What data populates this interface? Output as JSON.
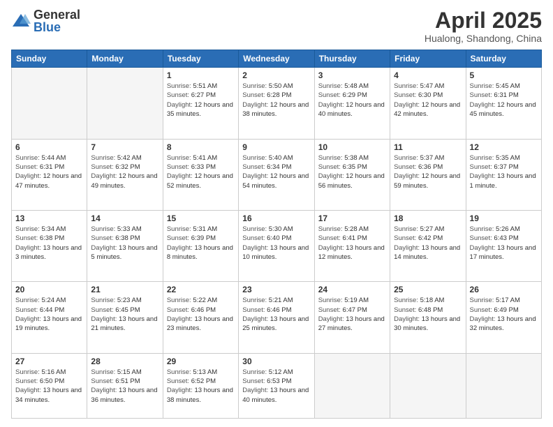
{
  "header": {
    "logo_general": "General",
    "logo_blue": "Blue",
    "month_title": "April 2025",
    "location": "Hualong, Shandong, China"
  },
  "days_of_week": [
    "Sunday",
    "Monday",
    "Tuesday",
    "Wednesday",
    "Thursday",
    "Friday",
    "Saturday"
  ],
  "weeks": [
    [
      {
        "day": "",
        "empty": true
      },
      {
        "day": "",
        "empty": true
      },
      {
        "day": "1",
        "sunrise": "5:51 AM",
        "sunset": "6:27 PM",
        "daylight": "12 hours and 35 minutes."
      },
      {
        "day": "2",
        "sunrise": "5:50 AM",
        "sunset": "6:28 PM",
        "daylight": "12 hours and 38 minutes."
      },
      {
        "day": "3",
        "sunrise": "5:48 AM",
        "sunset": "6:29 PM",
        "daylight": "12 hours and 40 minutes."
      },
      {
        "day": "4",
        "sunrise": "5:47 AM",
        "sunset": "6:30 PM",
        "daylight": "12 hours and 42 minutes."
      },
      {
        "day": "5",
        "sunrise": "5:45 AM",
        "sunset": "6:31 PM",
        "daylight": "12 hours and 45 minutes."
      }
    ],
    [
      {
        "day": "6",
        "sunrise": "5:44 AM",
        "sunset": "6:31 PM",
        "daylight": "12 hours and 47 minutes."
      },
      {
        "day": "7",
        "sunrise": "5:42 AM",
        "sunset": "6:32 PM",
        "daylight": "12 hours and 49 minutes."
      },
      {
        "day": "8",
        "sunrise": "5:41 AM",
        "sunset": "6:33 PM",
        "daylight": "12 hours and 52 minutes."
      },
      {
        "day": "9",
        "sunrise": "5:40 AM",
        "sunset": "6:34 PM",
        "daylight": "12 hours and 54 minutes."
      },
      {
        "day": "10",
        "sunrise": "5:38 AM",
        "sunset": "6:35 PM",
        "daylight": "12 hours and 56 minutes."
      },
      {
        "day": "11",
        "sunrise": "5:37 AM",
        "sunset": "6:36 PM",
        "daylight": "12 hours and 59 minutes."
      },
      {
        "day": "12",
        "sunrise": "5:35 AM",
        "sunset": "6:37 PM",
        "daylight": "13 hours and 1 minute."
      }
    ],
    [
      {
        "day": "13",
        "sunrise": "5:34 AM",
        "sunset": "6:38 PM",
        "daylight": "13 hours and 3 minutes."
      },
      {
        "day": "14",
        "sunrise": "5:33 AM",
        "sunset": "6:38 PM",
        "daylight": "13 hours and 5 minutes."
      },
      {
        "day": "15",
        "sunrise": "5:31 AM",
        "sunset": "6:39 PM",
        "daylight": "13 hours and 8 minutes."
      },
      {
        "day": "16",
        "sunrise": "5:30 AM",
        "sunset": "6:40 PM",
        "daylight": "13 hours and 10 minutes."
      },
      {
        "day": "17",
        "sunrise": "5:28 AM",
        "sunset": "6:41 PM",
        "daylight": "13 hours and 12 minutes."
      },
      {
        "day": "18",
        "sunrise": "5:27 AM",
        "sunset": "6:42 PM",
        "daylight": "13 hours and 14 minutes."
      },
      {
        "day": "19",
        "sunrise": "5:26 AM",
        "sunset": "6:43 PM",
        "daylight": "13 hours and 17 minutes."
      }
    ],
    [
      {
        "day": "20",
        "sunrise": "5:24 AM",
        "sunset": "6:44 PM",
        "daylight": "13 hours and 19 minutes."
      },
      {
        "day": "21",
        "sunrise": "5:23 AM",
        "sunset": "6:45 PM",
        "daylight": "13 hours and 21 minutes."
      },
      {
        "day": "22",
        "sunrise": "5:22 AM",
        "sunset": "6:46 PM",
        "daylight": "13 hours and 23 minutes."
      },
      {
        "day": "23",
        "sunrise": "5:21 AM",
        "sunset": "6:46 PM",
        "daylight": "13 hours and 25 minutes."
      },
      {
        "day": "24",
        "sunrise": "5:19 AM",
        "sunset": "6:47 PM",
        "daylight": "13 hours and 27 minutes."
      },
      {
        "day": "25",
        "sunrise": "5:18 AM",
        "sunset": "6:48 PM",
        "daylight": "13 hours and 30 minutes."
      },
      {
        "day": "26",
        "sunrise": "5:17 AM",
        "sunset": "6:49 PM",
        "daylight": "13 hours and 32 minutes."
      }
    ],
    [
      {
        "day": "27",
        "sunrise": "5:16 AM",
        "sunset": "6:50 PM",
        "daylight": "13 hours and 34 minutes."
      },
      {
        "day": "28",
        "sunrise": "5:15 AM",
        "sunset": "6:51 PM",
        "daylight": "13 hours and 36 minutes."
      },
      {
        "day": "29",
        "sunrise": "5:13 AM",
        "sunset": "6:52 PM",
        "daylight": "13 hours and 38 minutes."
      },
      {
        "day": "30",
        "sunrise": "5:12 AM",
        "sunset": "6:53 PM",
        "daylight": "13 hours and 40 minutes."
      },
      {
        "day": "",
        "empty": true
      },
      {
        "day": "",
        "empty": true
      },
      {
        "day": "",
        "empty": true
      }
    ]
  ],
  "labels": {
    "sunrise": "Sunrise: ",
    "sunset": "Sunset: ",
    "daylight": "Daylight: "
  }
}
